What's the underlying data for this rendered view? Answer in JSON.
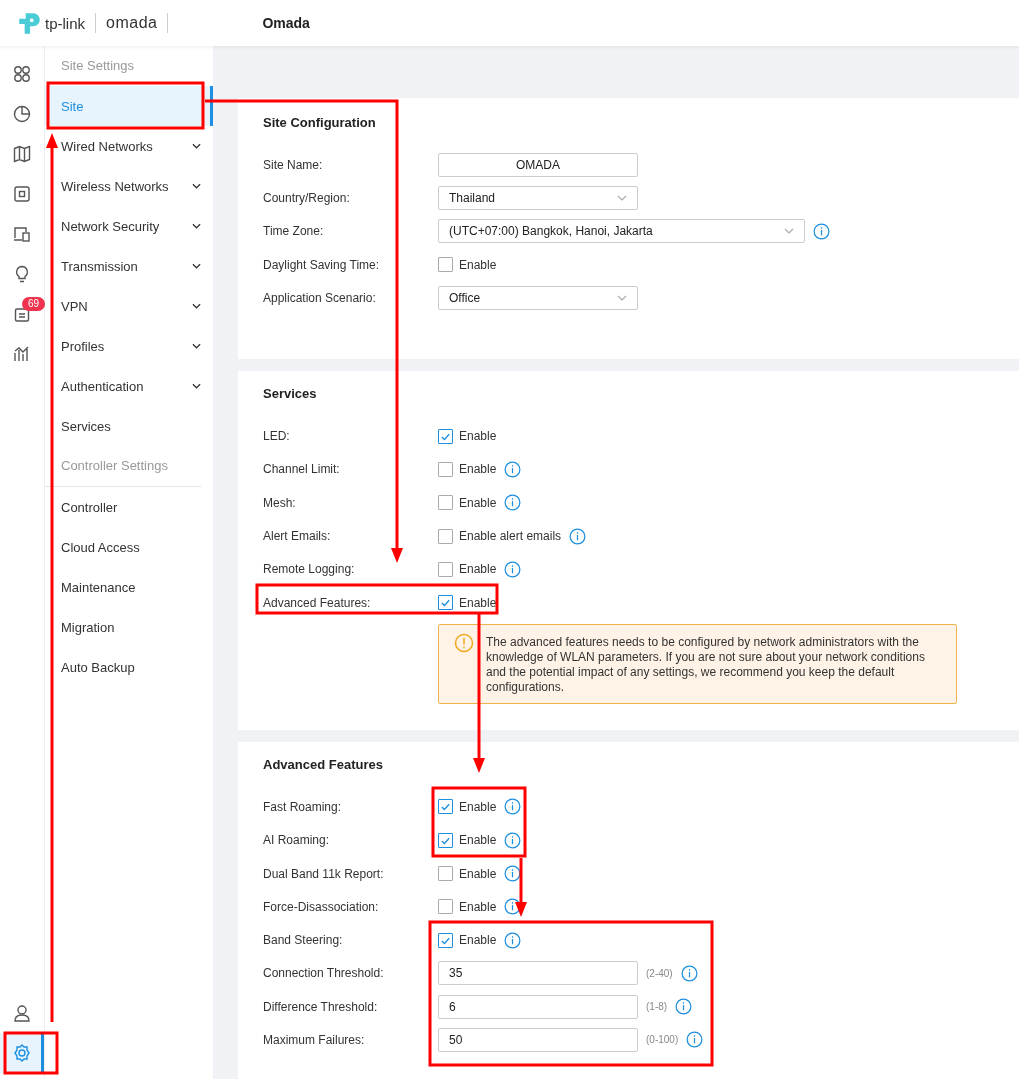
{
  "header": {
    "brand": "tp-link",
    "product": "omada",
    "title": "Omada"
  },
  "rail": [
    {
      "kind": "dashboard",
      "selected": false
    },
    {
      "kind": "statistics",
      "selected": false
    },
    {
      "kind": "map",
      "selected": false
    },
    {
      "kind": "devices",
      "selected": false
    },
    {
      "kind": "clients",
      "selected": false
    },
    {
      "kind": "insights",
      "selected": false
    },
    {
      "kind": "logs",
      "selected": false,
      "badge": "69"
    },
    {
      "kind": "reports",
      "selected": false
    }
  ],
  "rail_bottom": [
    {
      "kind": "account",
      "selected": false
    },
    {
      "kind": "settings",
      "selected": true
    }
  ],
  "sidebar": [
    {
      "kind": "heading",
      "label": "Site Settings"
    },
    {
      "kind": "item",
      "label": "Site",
      "expandable": false,
      "selected": true
    },
    {
      "kind": "item",
      "label": "Wired Networks",
      "expandable": true,
      "selected": false
    },
    {
      "kind": "item",
      "label": "Wireless Networks",
      "expandable": true,
      "selected": false
    },
    {
      "kind": "item",
      "label": "Network Security",
      "expandable": true,
      "selected": false
    },
    {
      "kind": "item",
      "label": "Transmission",
      "expandable": true,
      "selected": false
    },
    {
      "kind": "item",
      "label": "VPN",
      "expandable": true,
      "selected": false
    },
    {
      "kind": "item",
      "label": "Profiles",
      "expandable": true,
      "selected": false
    },
    {
      "kind": "item",
      "label": "Authentication",
      "expandable": true,
      "selected": false
    },
    {
      "kind": "item",
      "label": "Services",
      "expandable": false,
      "selected": false
    },
    {
      "kind": "heading",
      "label": "Controller Settings"
    },
    {
      "kind": "item",
      "label": "Controller",
      "expandable": false,
      "selected": false
    },
    {
      "kind": "item",
      "label": "Cloud Access",
      "expandable": false,
      "selected": false
    },
    {
      "kind": "item",
      "label": "Maintenance",
      "expandable": false,
      "selected": false
    },
    {
      "kind": "item",
      "label": "Migration",
      "expandable": false,
      "selected": false
    },
    {
      "kind": "item",
      "label": "Auto Backup",
      "expandable": false,
      "selected": false
    }
  ],
  "sections": [
    {
      "title": "Site Configuration",
      "rows": [
        {
          "kind": "text",
          "label": "Site Name:",
          "value": "OMADA"
        },
        {
          "kind": "select",
          "label": "Country/Region:",
          "value": "Thailand",
          "info": false,
          "wide": false
        },
        {
          "kind": "select",
          "label": "Time Zone:",
          "value": "(UTC+07:00) Bangkok, Hanoi, Jakarta",
          "info": true,
          "wide": true
        },
        {
          "kind": "checkbox",
          "label": "Daylight Saving Time:",
          "option": "Enable",
          "checked": false,
          "info": false
        },
        {
          "kind": "select",
          "label": "Application Scenario:",
          "value": "Office",
          "info": false,
          "wide": false
        }
      ]
    },
    {
      "title": "Services",
      "rows": [
        {
          "kind": "checkbox",
          "label": "LED:",
          "option": "Enable",
          "checked": true,
          "info": false
        },
        {
          "kind": "checkbox",
          "label": "Channel Limit:",
          "option": "Enable",
          "checked": false,
          "info": true
        },
        {
          "kind": "checkbox",
          "label": "Mesh:",
          "option": "Enable",
          "checked": false,
          "info": true
        },
        {
          "kind": "checkbox",
          "label": "Alert Emails:",
          "option": "Enable alert emails",
          "checked": false,
          "info": true
        },
        {
          "kind": "checkbox",
          "label": "Remote Logging:",
          "option": "Enable",
          "checked": false,
          "info": true
        },
        {
          "kind": "checkbox",
          "label": "Advanced Features:",
          "option": "Enable",
          "checked": true,
          "info": false
        },
        {
          "kind": "warning",
          "text": "The advanced features needs to be configured by network administrators with the knowledge of WLAN parameters. If you are not sure about your network conditions and the potential impact of any settings, we recommend you keep the default configurations."
        }
      ]
    },
    {
      "title": "Advanced Features",
      "rows": [
        {
          "kind": "checkbox",
          "label": "Fast Roaming:",
          "option": "Enable",
          "checked": true,
          "info": true
        },
        {
          "kind": "checkbox",
          "label": "AI Roaming:",
          "option": "Enable",
          "checked": true,
          "info": true
        },
        {
          "kind": "checkbox",
          "label": "Dual Band 11k Report:",
          "option": "Enable",
          "checked": false,
          "info": true
        },
        {
          "kind": "checkbox",
          "label": "Force-Disassociation:",
          "option": "Enable",
          "checked": false,
          "info": true
        },
        {
          "kind": "checkbox",
          "label": "Band Steering:",
          "option": "Enable",
          "checked": true,
          "info": true
        },
        {
          "kind": "number",
          "label": "Connection Threshold:",
          "value": "35",
          "range": "(2-40)",
          "info": true
        },
        {
          "kind": "number",
          "label": "Difference Threshold:",
          "value": "6",
          "range": "(1-8)",
          "info": true
        },
        {
          "kind": "number",
          "label": "Maximum Failures:",
          "value": "50",
          "range": "(0-100)",
          "info": true
        }
      ]
    }
  ]
}
